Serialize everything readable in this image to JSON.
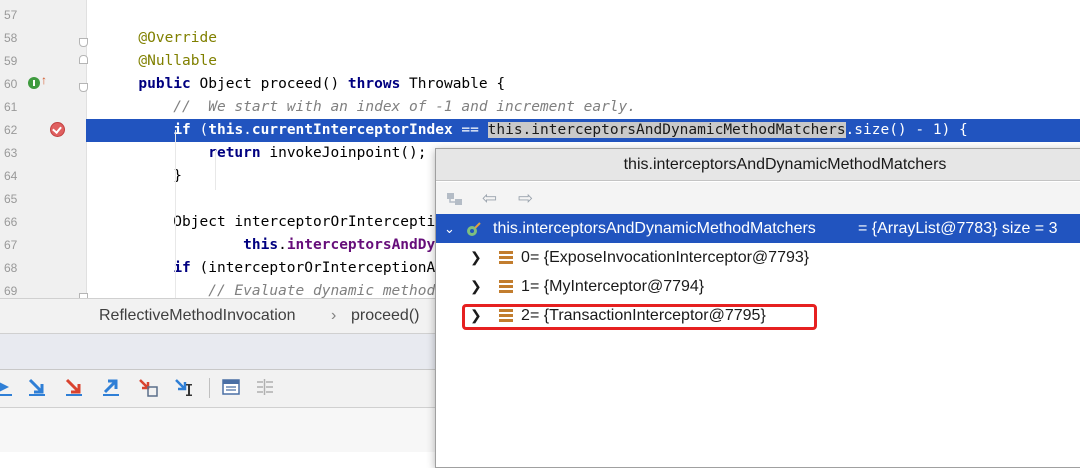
{
  "editor": {
    "line_numbers": [
      "57",
      "58",
      "59",
      "60",
      "61",
      "62",
      "63",
      "64",
      "65",
      "66",
      "67",
      "68",
      "69"
    ],
    "lines": [
      {
        "segments": []
      },
      {
        "segments": [
          {
            "t": "    @Override",
            "c": "ann"
          }
        ]
      },
      {
        "segments": [
          {
            "t": "    @Nullable",
            "c": "ann"
          }
        ]
      },
      {
        "segments": [
          {
            "t": "    ",
            "c": ""
          },
          {
            "t": "public",
            "c": "kw"
          },
          {
            "t": " Object proceed() ",
            "c": ""
          },
          {
            "t": "throws",
            "c": "kw"
          },
          {
            "t": " Throwable {",
            "c": ""
          }
        ]
      },
      {
        "segments": [
          {
            "t": "        //  We start with an index of -1 and increment early.",
            "c": "cmt"
          }
        ]
      },
      {
        "segments": [
          {
            "t": "        ",
            "c": ""
          },
          {
            "t": "if",
            "c": "kw"
          },
          {
            "t": " (",
            "c": ""
          },
          {
            "t": "this",
            "c": "kw"
          },
          {
            "t": ".",
            "c": ""
          },
          {
            "t": "currentInterceptorIndex",
            "c": "fld"
          },
          {
            "t": " == ",
            "c": ""
          },
          {
            "t": "this.interceptorsAndDynamicMethodMatchers",
            "c": "hl"
          },
          {
            "t": ".size() - 1) {",
            "c": ""
          }
        ]
      },
      {
        "segments": [
          {
            "t": "            ",
            "c": ""
          },
          {
            "t": "return",
            "c": "kw"
          },
          {
            "t": " invokeJoinpoint();",
            "c": ""
          }
        ]
      },
      {
        "segments": [
          {
            "t": "        }",
            "c": ""
          }
        ]
      },
      {
        "segments": []
      },
      {
        "segments": [
          {
            "t": "        Object interceptorOrInterceptionAdvice =",
            "c": ""
          }
        ]
      },
      {
        "segments": [
          {
            "t": "                ",
            "c": ""
          },
          {
            "t": "this",
            "c": "kw"
          },
          {
            "t": ".",
            "c": ""
          },
          {
            "t": "interceptorsAndDynamicMethodMatchers",
            "c": "fld"
          },
          {
            "t": ".get(++",
            "c": ""
          },
          {
            "t": "this",
            "c": "kw"
          },
          {
            "t": ".",
            "c": ""
          },
          {
            "t": "currentInterceptorIndex",
            "c": "fld"
          },
          {
            "t": ");",
            "c": ""
          }
        ]
      },
      {
        "segments": [
          {
            "t": "        ",
            "c": ""
          },
          {
            "t": "if",
            "c": "kw"
          },
          {
            "t": " (interceptorOrInterceptionAdvice ",
            "c": ""
          },
          {
            "t": "instanceof",
            "c": "kw"
          },
          {
            "t": " InterceptorAndDynamicMethodMatcher) {",
            "c": ""
          }
        ]
      },
      {
        "segments": [
          {
            "t": "            // Evaluate dynamic method matcher here",
            "c": "cmt"
          }
        ]
      }
    ]
  },
  "breadcrumb": {
    "class_name": "ReflectiveMethodInvocation",
    "separator": "›",
    "method_name": "proceed()"
  },
  "popup": {
    "title": "this.interceptorsAndDynamicMethodMatchers",
    "root": {
      "name": "this.interceptorsAndDynamicMethodMatchers",
      "value": " = {ArrayList@7783}  size = 3"
    },
    "items": [
      {
        "index": "0",
        "value": " = {ExposeInvocationInterceptor@7793}"
      },
      {
        "index": "1",
        "value": " = {MyInterceptor@7794}"
      },
      {
        "index": "2",
        "value": " = {TransactionInterceptor@7795}"
      }
    ]
  },
  "colors": {
    "selection": "#2154bf",
    "highlight_box": "#e62020",
    "list_icon": "#c27d2e"
  }
}
